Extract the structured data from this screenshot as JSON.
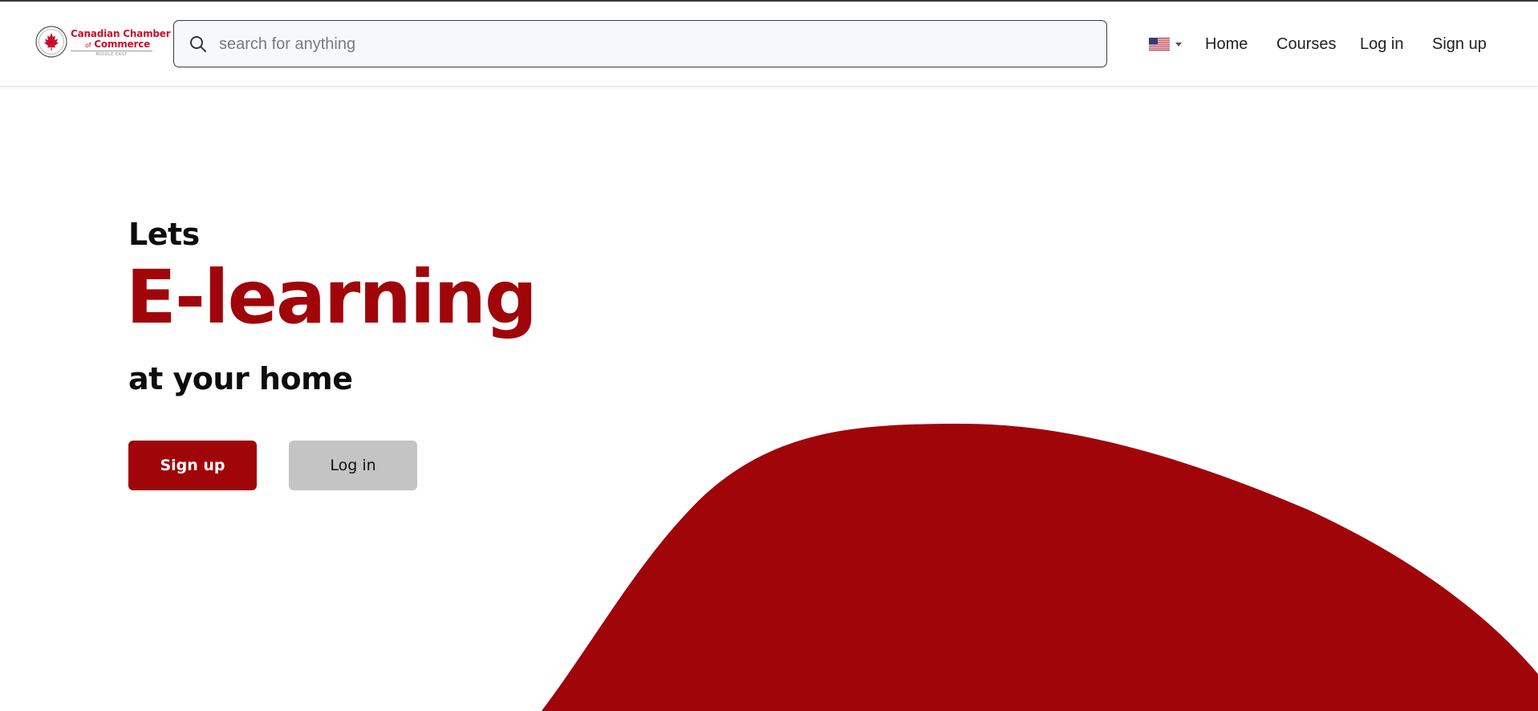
{
  "brand": {
    "logo_line1": "Canadian Chamber",
    "logo_line2_prefix": "of",
    "logo_line2": "Commerce",
    "logo_subline": "MIDDLE EAST"
  },
  "search": {
    "placeholder": "search for anything",
    "value": ""
  },
  "language": {
    "selected": "United States",
    "icon": "us-flag-icon"
  },
  "nav": {
    "home": "Home",
    "courses": "Courses",
    "login": "Log in",
    "signup": "Sign up"
  },
  "hero": {
    "pre_title": "Lets",
    "title": "E-learning",
    "subtitle": "at your home",
    "signup_label": "Sign up",
    "login_label": "Log in"
  },
  "colors": {
    "accent": "#a0050a",
    "secondary_button": "#c4c4c4",
    "logo_red": "#c8102e"
  }
}
